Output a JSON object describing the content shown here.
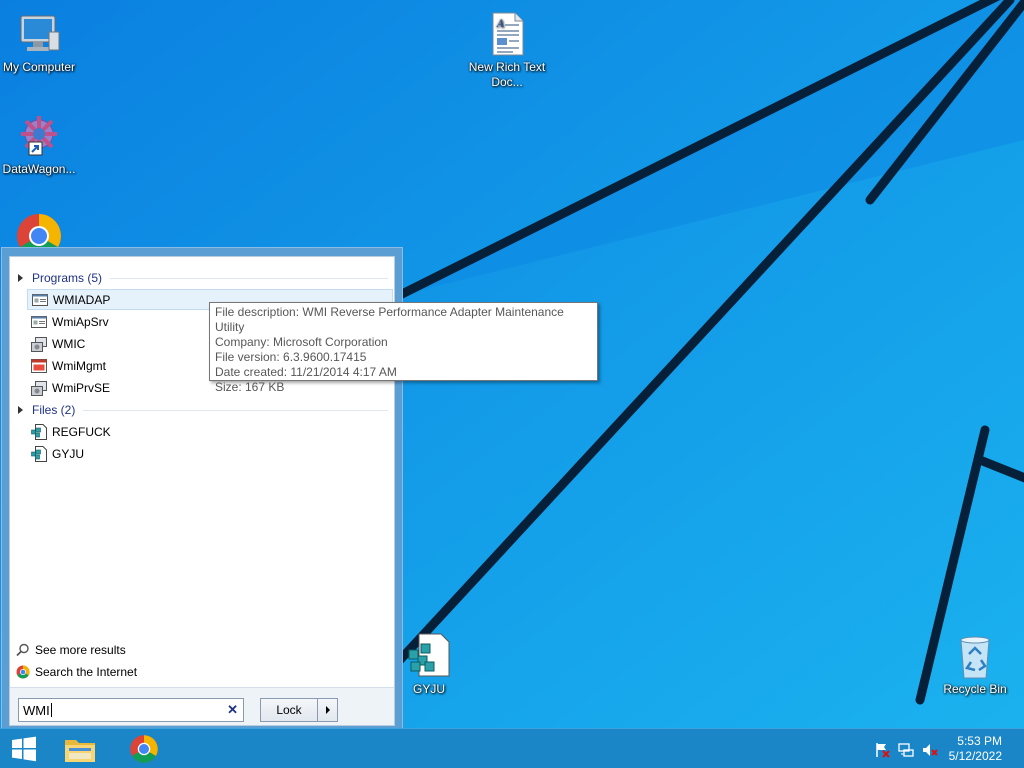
{
  "desktop": {
    "icons": [
      {
        "label": "My Computer",
        "icon": "computer-icon"
      },
      {
        "label": "DataWagon...",
        "icon": "gear-shortcut-icon"
      },
      {
        "label": "",
        "icon": "chrome-icon"
      },
      {
        "label": "New Rich Text Doc...",
        "icon": "document-icon"
      },
      {
        "label": "GYJU",
        "icon": "registry-file-icon"
      },
      {
        "label": "Recycle Bin",
        "icon": "recycle-bin-icon"
      }
    ]
  },
  "start_search": {
    "groups": [
      {
        "header": "Programs (5)",
        "items": [
          {
            "label": "WMIADAP",
            "icon": "app-window-icon",
            "selected": true
          },
          {
            "label": "WmiApSrv",
            "icon": "app-window-icon"
          },
          {
            "label": "WMIC",
            "icon": "console-app-icon"
          },
          {
            "label": "WmiMgmt",
            "icon": "mmc-icon"
          },
          {
            "label": "WmiPrvSE",
            "icon": "console-app-icon"
          }
        ]
      },
      {
        "header": "Files (2)",
        "items": [
          {
            "label": "REGFUCK",
            "icon": "registry-file-icon"
          },
          {
            "label": "GYJU",
            "icon": "registry-file-icon"
          }
        ]
      }
    ],
    "see_more": "See more results",
    "search_internet": "Search the Internet",
    "query": "WMI",
    "lock_label": "Lock"
  },
  "tooltip": {
    "lines": [
      "File description: WMI Reverse Performance Adapter Maintenance Utility",
      "Company: Microsoft Corporation",
      "File version: 6.3.9600.17415",
      "Date created: 11/21/2014 4:17 AM",
      "Size: 167 KB"
    ]
  },
  "taskbar": {
    "pinned": [
      "windows-start-icon",
      "file-explorer-icon",
      "chrome-icon"
    ],
    "tray": [
      "action-center-flag-icon",
      "network-icon",
      "volume-muted-icon"
    ],
    "time": "5:53 PM",
    "date": "5/12/2022"
  },
  "colors": {
    "wallpaper": "#0d8fe6",
    "panel_frame": "#5b9ed4",
    "group_header": "#1e3287",
    "selection": "#e5f1fb"
  }
}
